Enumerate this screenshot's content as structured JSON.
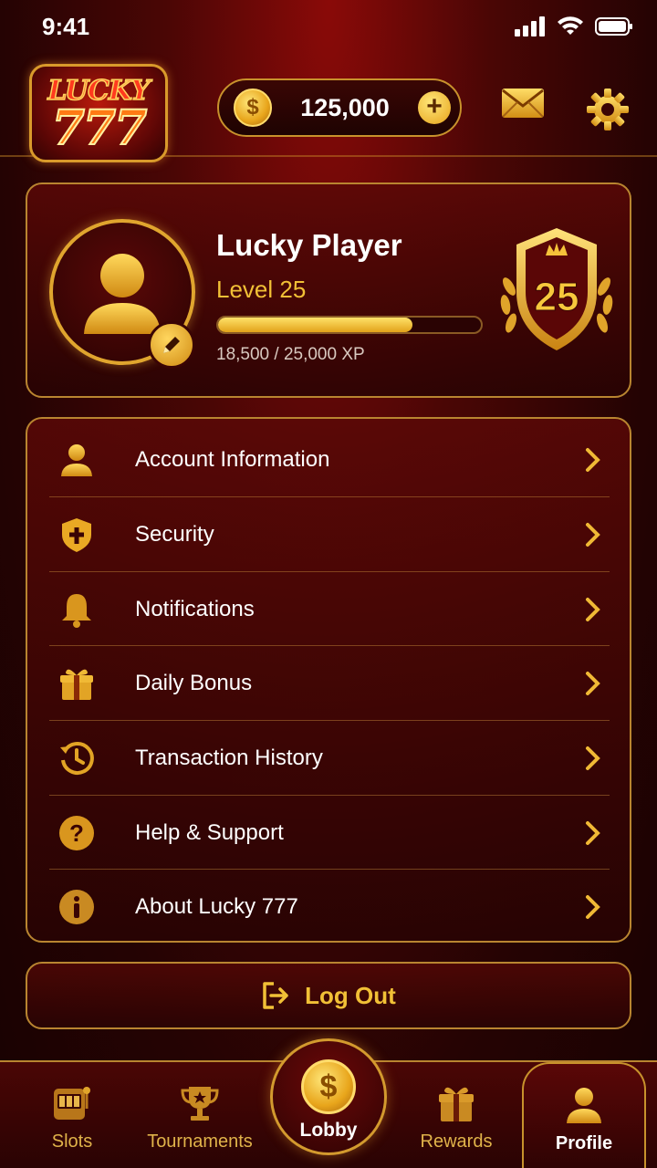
{
  "status_bar": {
    "time": "9:41"
  },
  "header": {
    "logo_word": "LUCKY",
    "logo_number": "777",
    "coin_balance": "125,000",
    "coin_symbol": "$",
    "add_symbol": "+"
  },
  "profile": {
    "name": "Lucky Player",
    "level_label": "Level 25",
    "xp_text": "18,500 / 25,000 XP",
    "xp_progress": 0.74,
    "badge_level": "25"
  },
  "menu": {
    "items": [
      {
        "label": "Account Information",
        "icon": "person-icon"
      },
      {
        "label": "Security",
        "icon": "shield-icon"
      },
      {
        "label": "Notifications",
        "icon": "bell-icon"
      },
      {
        "label": "Daily Bonus",
        "icon": "gift-icon"
      },
      {
        "label": "Transaction History",
        "icon": "history-icon"
      },
      {
        "label": "Help & Support",
        "icon": "help-icon"
      },
      {
        "label": "About Lucky 777",
        "icon": "info-icon"
      }
    ]
  },
  "logout": {
    "label": "Log Out"
  },
  "bottom_nav": {
    "slots": "Slots",
    "tournaments": "Tournaments",
    "lobby": "Lobby",
    "rewards": "Rewards",
    "profile": "Profile",
    "active": "Profile"
  },
  "colors": {
    "gold": "#f3c233",
    "deep_red": "#4a0605",
    "accent_border": "#b98530"
  }
}
